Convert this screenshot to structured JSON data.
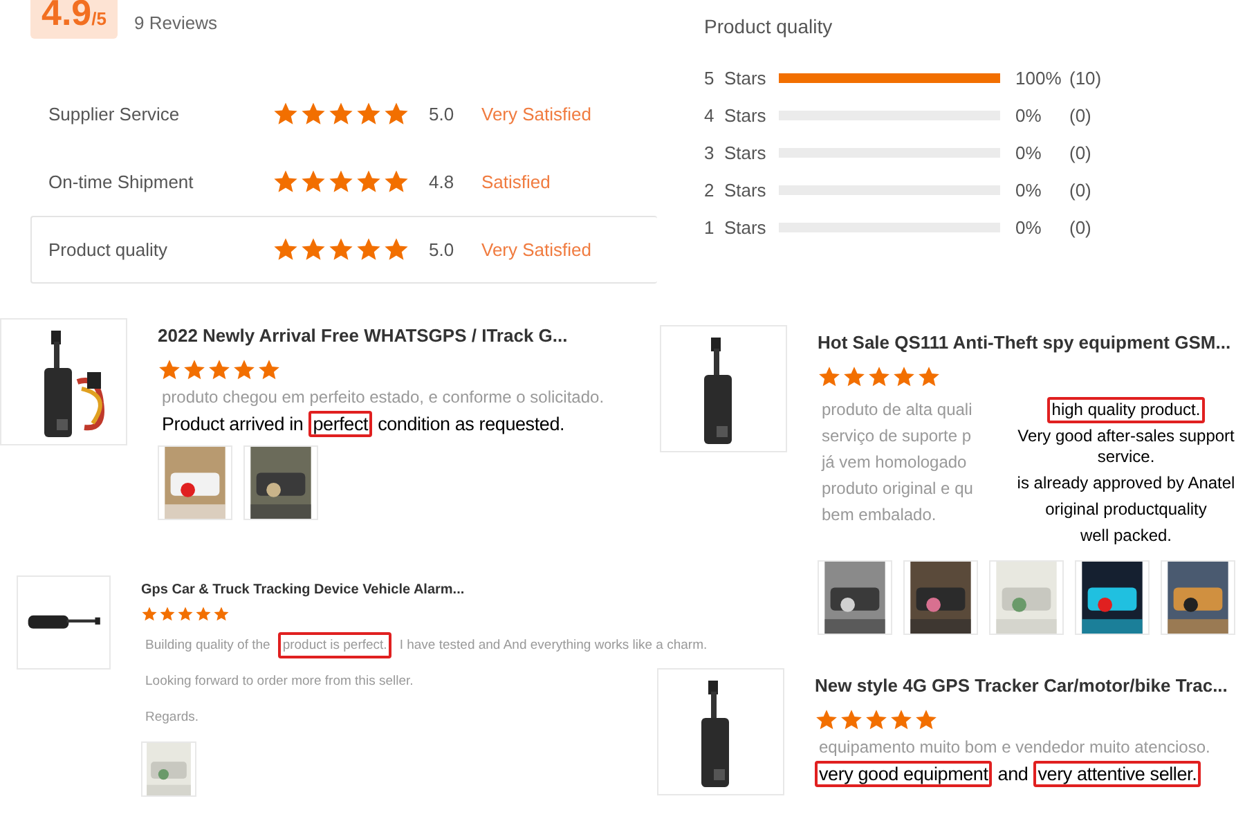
{
  "summary": {
    "score": "4.9",
    "out_of": "/5",
    "reviews": "9 Reviews"
  },
  "ratings": [
    {
      "label": "Supplier Service",
      "stars": 5,
      "value": "5.0",
      "verdict": "Very Satisfied",
      "selected": false
    },
    {
      "label": "On-time Shipment",
      "stars": 5,
      "value": "4.8",
      "verdict": "Satisfied",
      "selected": false
    },
    {
      "label": "Product quality",
      "stars": 5,
      "value": "5.0",
      "verdict": "Very Satisfied",
      "selected": true
    }
  ],
  "breakdown": {
    "title": "Product quality",
    "rows": [
      {
        "label": "5  Stars",
        "level": 1,
        "percent": "100%",
        "count": "(10)"
      },
      {
        "label": "4  Stars",
        "level": 0,
        "percent": "0%",
        "count": "(0)"
      },
      {
        "label": "3  Stars",
        "level": 0,
        "percent": "0%",
        "count": "(0)"
      },
      {
        "label": "2  Stars",
        "level": 0,
        "percent": "0%",
        "count": "(0)"
      },
      {
        "label": "1  Stars",
        "level": 0,
        "percent": "0%",
        "count": "(0)"
      }
    ]
  },
  "reviews": [
    {
      "kind": "stacked",
      "title": "2022 Newly Arrival Free WHATSGPS / ITrack G...",
      "stars": 5,
      "original": [
        [
          {
            "text": "produto chegou em perfeito estado, e conforme o solicitado.",
            "highlighted": false
          }
        ]
      ],
      "translation": [
        [
          {
            "text": "Product arrived in",
            "highlighted": false
          },
          {
            "text": "perfect",
            "highlighted": true
          },
          {
            "text": "condition as requested.",
            "highlighted": false
          }
        ]
      ],
      "photos": [
        {
          "kind": "picture"
        },
        {
          "kind": "picture"
        }
      ]
    },
    {
      "kind": "side",
      "title": "Hot Sale QS111 Anti-Theft spy equipment GSM...",
      "stars": 5,
      "original": [
        [
          {
            "text": "produto de alta quali",
            "highlighted": false
          }
        ],
        [
          {
            "text": "serviço de suporte p",
            "highlighted": false
          }
        ],
        [
          {
            "text": "já vem homologado",
            "highlighted": false
          }
        ],
        [
          {
            "text": "produto original e qu",
            "highlighted": false
          }
        ],
        [
          {
            "text": "bem embalado.",
            "highlighted": false
          }
        ]
      ],
      "translation": [
        [
          {
            "text": "high quality product.",
            "highlighted": true
          }
        ],
        [
          {
            "text": "Very good after-sales support service.",
            "highlighted": false
          }
        ],
        [
          {
            "text": "is already approved by Anatel",
            "highlighted": false
          }
        ],
        [
          {
            "text": "original productquality",
            "highlighted": false
          }
        ],
        [
          {
            "text": "well packed.",
            "highlighted": false
          }
        ]
      ],
      "photos": [
        {
          "kind": "picture"
        },
        {
          "kind": "picture"
        },
        {
          "kind": "picture"
        },
        {
          "kind": "picture"
        },
        {
          "kind": "picture"
        }
      ]
    },
    {
      "kind": "compact",
      "title": "Gps Car & Truck Tracking Device Vehicle Alarm...",
      "stars": 5,
      "original": [
        [
          {
            "text": "Building quality of the",
            "highlighted": false
          },
          {
            "text": "product is perfect.",
            "highlighted": true
          },
          {
            "text": "I have tested and And everything works like a charm.",
            "highlighted": false
          }
        ],
        [
          {
            "text": "Looking forward to order more from this seller.",
            "highlighted": false
          }
        ],
        [
          {
            "text": "Regards.",
            "highlighted": false
          }
        ]
      ],
      "photos": [
        {
          "kind": "picture"
        }
      ]
    },
    {
      "kind": "stacked",
      "title": "New style 4G GPS Tracker Car/motor/bike Trac...",
      "stars": 5,
      "original": [
        [
          {
            "text": "equipamento muito bom e vendedor muito atencioso.",
            "highlighted": false
          }
        ]
      ],
      "translation": [
        [
          {
            "text": "very good equipment",
            "highlighted": true
          },
          {
            "text": "and",
            "highlighted": false
          },
          {
            "text": "very attentive seller.",
            "highlighted": true
          }
        ]
      ]
    }
  ]
}
